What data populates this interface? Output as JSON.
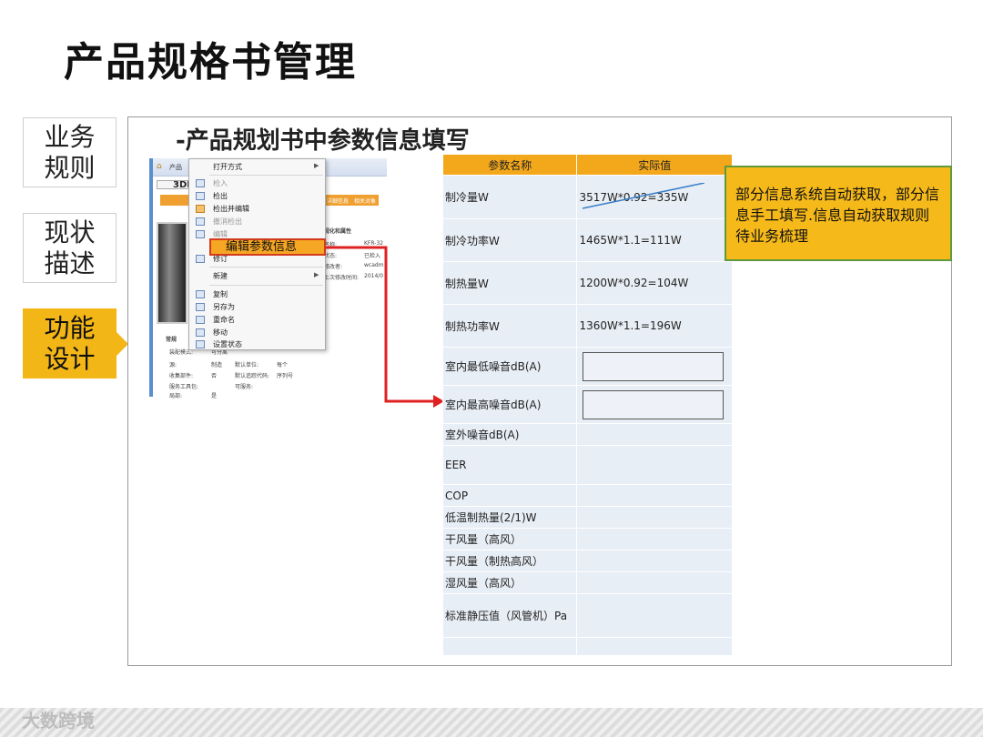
{
  "slide": {
    "title": "产品规格书管理"
  },
  "sidebar": {
    "items": [
      {
        "label": "业务\n规则",
        "active": false
      },
      {
        "label": "现状\n描述",
        "active": false
      },
      {
        "label": "功能\n设计",
        "active": true
      }
    ]
  },
  "section": {
    "title": "-产品规划书中参数信息填写"
  },
  "app": {
    "header_label": "产品",
    "model_title": "3DN1Y-CE(A2),",
    "tabs": [
      "详细信息",
      "相关对象",
      "流程能力"
    ],
    "panel_heading": "视化和属性",
    "props": [
      {
        "label": "名称:",
        "value": "KFR-32"
      },
      {
        "label": "状态:",
        "value": "已检入"
      },
      {
        "label": "修改者:",
        "value": "wcadm"
      },
      {
        "label": "上次修改时间:",
        "value": "2014/0"
      }
    ],
    "lower_props": [
      {
        "label": "常规",
        "value": ""
      },
      {
        "label": "装配模式:",
        "value": "可分离"
      },
      {
        "label": "源:",
        "value": "制造"
      },
      {
        "label": "收集部件:",
        "value": "否"
      },
      {
        "label": "服务工具包:",
        "value": ""
      },
      {
        "label": "默认单位:",
        "value": "每个"
      },
      {
        "label": "默认追踪代码:",
        "value": "序列号"
      },
      {
        "label": "可服务:",
        "value": ""
      },
      {
        "label": "局部:",
        "value": "是"
      }
    ]
  },
  "context_menu": {
    "items": [
      {
        "label": "打开方式",
        "submenu": true,
        "disabled": false
      },
      {
        "label": "检入",
        "submenu": false,
        "disabled": true
      },
      {
        "label": "检出",
        "submenu": false,
        "disabled": false
      },
      {
        "label": "检出并编辑",
        "submenu": false,
        "disabled": false
      },
      {
        "label": "撤消检出",
        "submenu": false,
        "disabled": true
      },
      {
        "label": "编辑",
        "submenu": false,
        "disabled": true
      },
      {
        "label": "修订",
        "submenu": false,
        "disabled": false
      },
      {
        "label": "新建",
        "submenu": true,
        "disabled": false
      },
      {
        "label": "复制",
        "submenu": false,
        "disabled": false
      },
      {
        "label": "另存为",
        "submenu": false,
        "disabled": false
      },
      {
        "label": "重命名",
        "submenu": false,
        "disabled": false
      },
      {
        "label": "移动",
        "submenu": false,
        "disabled": false
      },
      {
        "label": "设置状态",
        "submenu": false,
        "disabled": false
      }
    ],
    "highlighted": "编辑参数信息"
  },
  "param_table": {
    "headers": [
      "参数名称",
      "实际值"
    ],
    "rows": [
      {
        "name": "制冷量W",
        "value": "3517W*0.92=335W"
      },
      {
        "name": "制冷功率W",
        "value": "1465W*1.1=111W"
      },
      {
        "name": "制热量W",
        "value": "1200W*0.92=104W"
      },
      {
        "name": "制热功率W",
        "value": "1360W*1.1=196W"
      },
      {
        "name": "室内最低噪音dB(A)",
        "value": ""
      },
      {
        "name": "室内最高噪音dB(A)",
        "value": ""
      },
      {
        "name": "室外噪音dB(A)",
        "value": ""
      },
      {
        "name": "EER",
        "value": ""
      },
      {
        "name": "COP",
        "value": ""
      },
      {
        "name": "低温制热量(2/1)W",
        "value": ""
      },
      {
        "name": "干风量（高风）",
        "value": ""
      },
      {
        "name": "干风量（制热高风）",
        "value": ""
      },
      {
        "name": "湿风量（高风）",
        "value": ""
      },
      {
        "name": "标准静压值（风管机）Pa",
        "value": ""
      },
      {
        "name": "",
        "value": ""
      }
    ]
  },
  "callout": {
    "text": "部分信息系统自动获取，部分信息手工填写.信息自动获取规则待业务梳理"
  },
  "watermark": {
    "text": "大数跨境"
  },
  "colors": {
    "accent": "#f3b617",
    "table_header": "#f3a81c",
    "arrow": "#e02020",
    "callout_border": "#5e9a3c"
  }
}
